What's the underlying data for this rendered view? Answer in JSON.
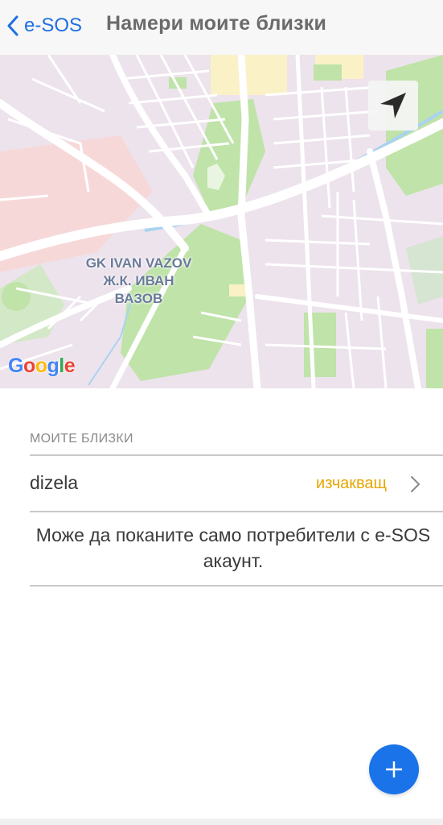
{
  "navbar": {
    "back_label": "e-SOS",
    "title": "Намери моите близки"
  },
  "map": {
    "area_label_line1": "GK IVAN VAZOV",
    "area_label_line2": "Ж.К. ИВАН",
    "area_label_line3": "ВАЗОВ",
    "logo": [
      "G",
      "o",
      "o",
      "g",
      "l",
      "e"
    ],
    "logo_colors": [
      "#4285F4",
      "#EA4335",
      "#FBBC05",
      "#4285F4",
      "#34A853",
      "#EA4335"
    ]
  },
  "contacts": {
    "section_title": "МОИТЕ БЛИЗКИ",
    "items": [
      {
        "name": "dizela",
        "status": "изчакващ"
      }
    ],
    "hint": "Може да поканите само потребители с e-SOS акаунт."
  },
  "colors": {
    "accent": "#1a73e8",
    "pending": "#e7a500"
  },
  "icons": {
    "back": "chevron-left-icon",
    "locate": "navigation-arrow-icon",
    "row": "chevron-right-icon",
    "add": "plus-icon"
  }
}
